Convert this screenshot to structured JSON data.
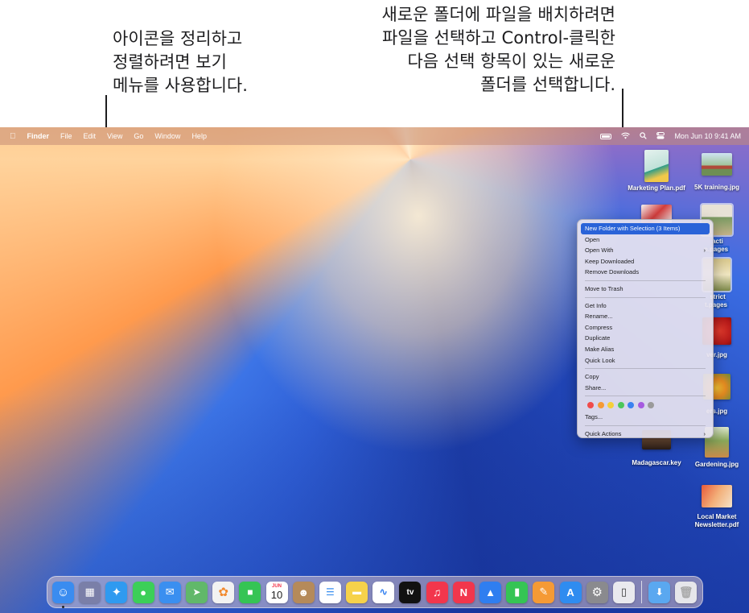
{
  "callouts": {
    "left": [
      "아이콘을 정리하고",
      "정렬하려면 보기",
      "메뉴를 사용합니다."
    ],
    "right": [
      "새로운 폴더에 파일을 배치하려면",
      "파일을 선택하고 Control-클릭한",
      "다음 선택 항목이 있는 새로운",
      "폴더를 선택합니다."
    ]
  },
  "menubar": {
    "apple": "",
    "items": [
      "Finder",
      "File",
      "Edit",
      "View",
      "Go",
      "Window",
      "Help"
    ],
    "clock": "Mon Jun 10  9:41 AM"
  },
  "desktop_icons": [
    {
      "label": "Marketing Plan.pdf",
      "selected": false
    },
    {
      "label": "5K training.jpg",
      "selected": false
    },
    {
      "label": "acti\nn.pages",
      "selected": true
    },
    {
      "label": "strict\nt.pages",
      "selected": true
    },
    {
      "label": "ver.jpg",
      "selected": false
    },
    {
      "label": "ers.jpg",
      "selected": false
    },
    {
      "label": "Madagascar.key",
      "selected": false
    },
    {
      "label": "Gardening.jpg",
      "selected": false
    },
    {
      "label": "Local Market\nNewsletter.pdf",
      "selected": false
    }
  ],
  "context_menu": {
    "items": [
      {
        "label": "New Folder with Selection (3 Items)",
        "highlighted": true
      },
      {
        "label": "Open"
      },
      {
        "label": "Open With",
        "submenu": true
      },
      {
        "label": "Keep Downloaded"
      },
      {
        "label": "Remove Downloads"
      },
      {
        "label": "Move to Trash"
      },
      {
        "label": "Get Info"
      },
      {
        "label": "Rename..."
      },
      {
        "label": "Compress"
      },
      {
        "label": "Duplicate"
      },
      {
        "label": "Make Alias"
      },
      {
        "label": "Quick Look"
      },
      {
        "label": "Copy"
      },
      {
        "label": "Share..."
      },
      {
        "label": "Tags..."
      },
      {
        "label": "Quick Actions",
        "submenu": true
      }
    ],
    "tag_colors": [
      "#f04b4b",
      "#f59a35",
      "#f5cf3a",
      "#4cc75a",
      "#3b82f0",
      "#a65be0",
      "#9a9a9a"
    ],
    "submenu_glyph": "›"
  },
  "dock": {
    "calendar_month": "JUN",
    "calendar_day": "10",
    "tv_label": "tv",
    "apps": [
      {
        "name": "finder",
        "color": "#3a8cf0"
      },
      {
        "name": "launchpad",
        "color": "#7a7fa8"
      },
      {
        "name": "safari",
        "color": "#2f9af0"
      },
      {
        "name": "messages",
        "color": "#3ccf58"
      },
      {
        "name": "mail",
        "color": "#3a8ff0"
      },
      {
        "name": "maps",
        "color": "#61b86a"
      },
      {
        "name": "photos",
        "color": "#f2f2f2"
      },
      {
        "name": "facetime",
        "color": "#35c454"
      },
      {
        "name": "calendar",
        "color": "#ffffff"
      },
      {
        "name": "contacts",
        "color": "#b58a5a"
      },
      {
        "name": "reminders",
        "color": "#ffffff"
      },
      {
        "name": "notes",
        "color": "#f6d24a"
      },
      {
        "name": "freeform",
        "color": "#ffffff"
      },
      {
        "name": "tv",
        "color": "#111111"
      },
      {
        "name": "music",
        "color": "#f2364c"
      },
      {
        "name": "news",
        "color": "#f2364c"
      },
      {
        "name": "keynote",
        "color": "#2f7ef0"
      },
      {
        "name": "numbers",
        "color": "#35c454"
      },
      {
        "name": "pages",
        "color": "#f59a35"
      },
      {
        "name": "app-store",
        "color": "#2f8cf0"
      },
      {
        "name": "system-settings",
        "color": "#8a8a8e"
      },
      {
        "name": "iphone-mirroring",
        "color": "#e9e9ee"
      }
    ],
    "extras": [
      {
        "name": "downloads-folder",
        "color": "#5aa8f0"
      },
      {
        "name": "trash",
        "color": "#e6e6ea"
      }
    ]
  }
}
